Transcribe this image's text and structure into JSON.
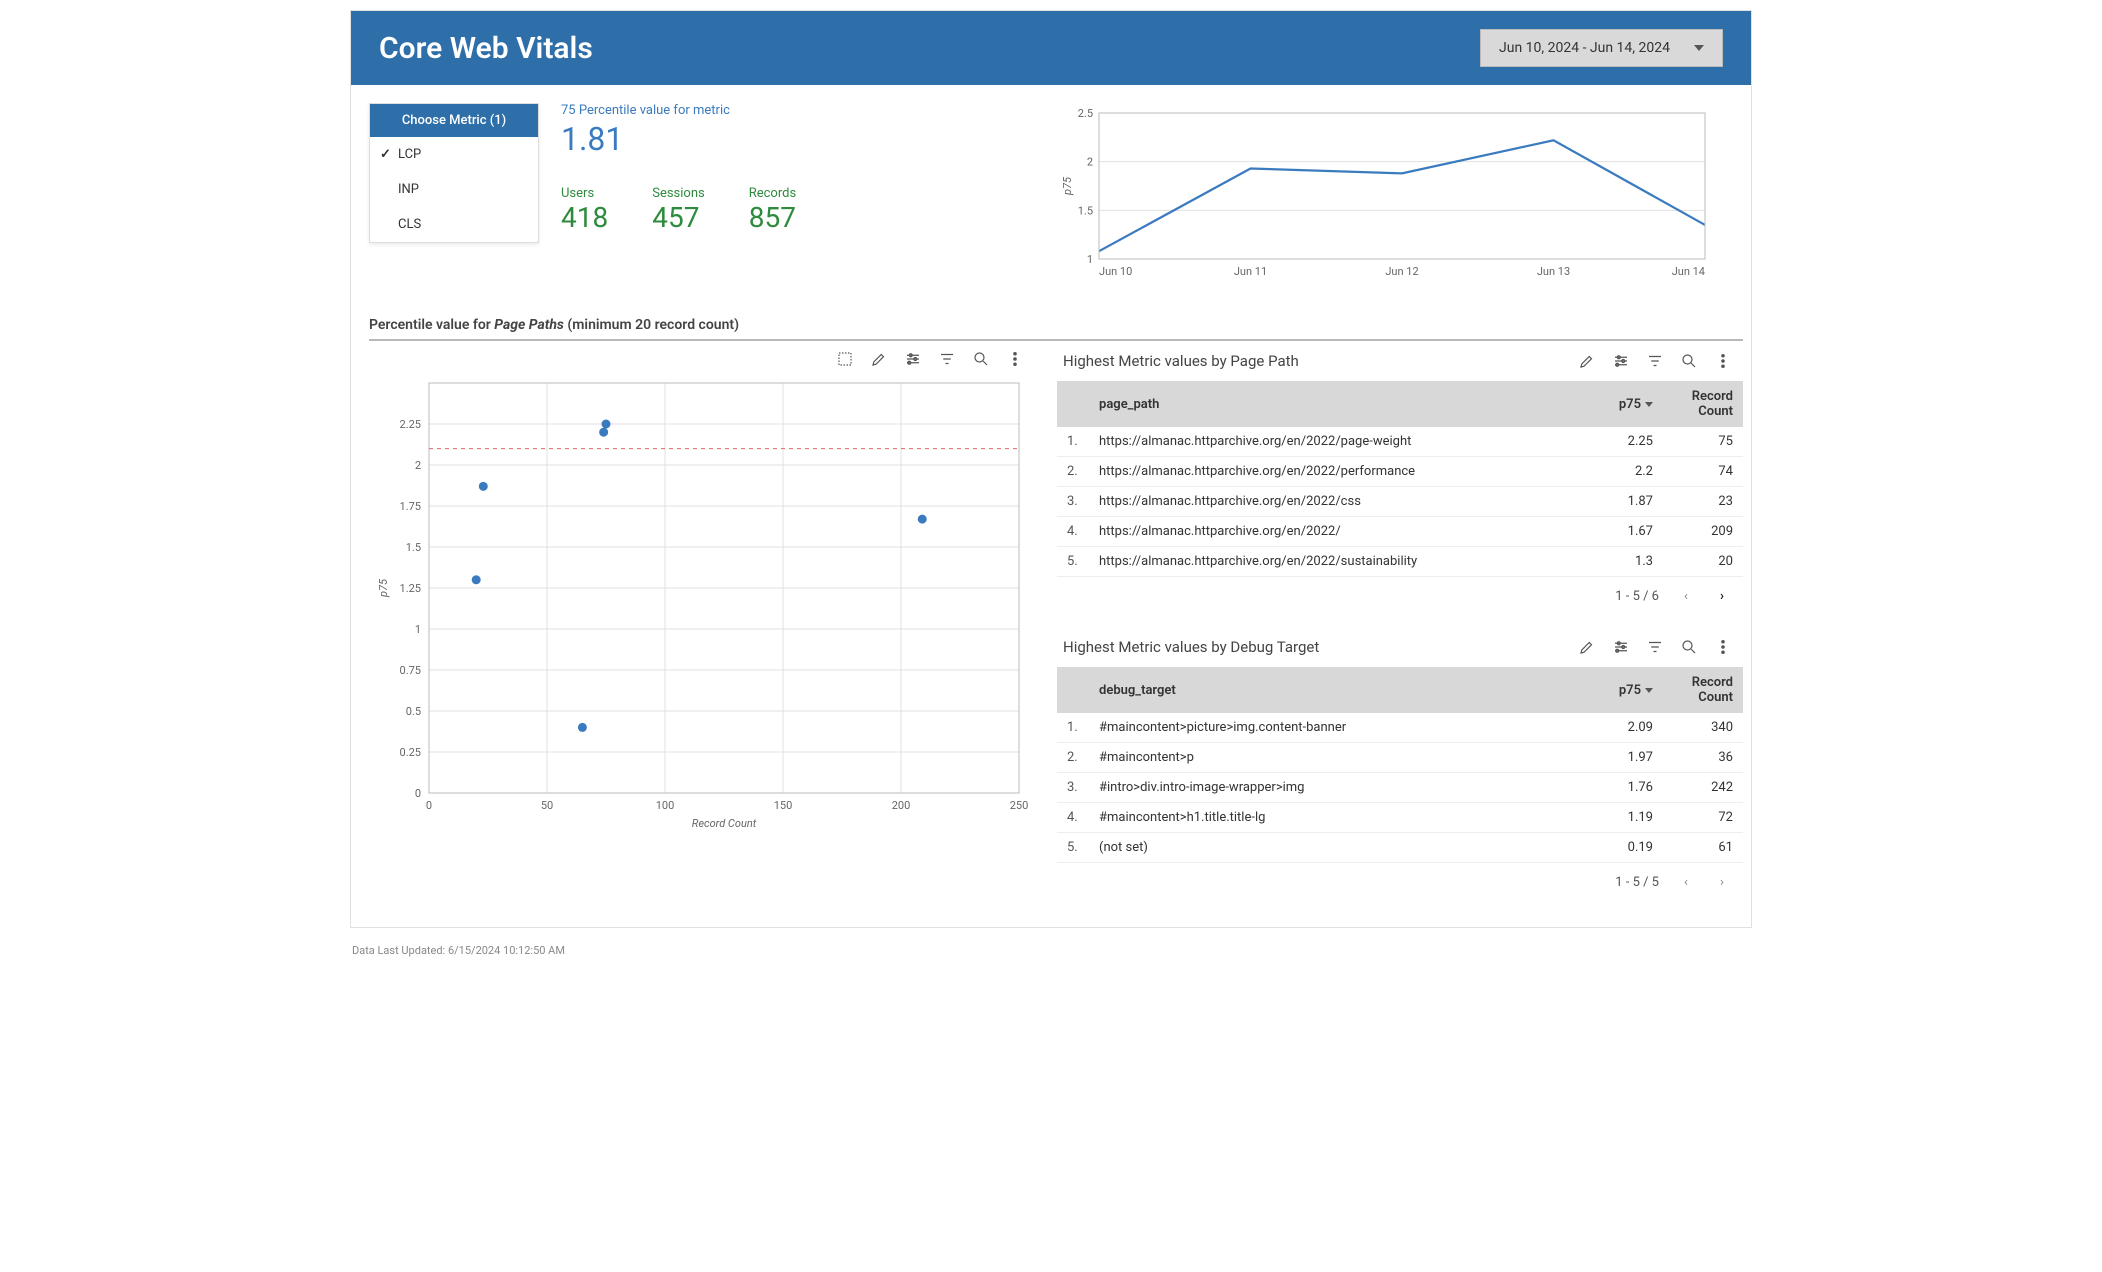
{
  "header": {
    "title": "Core Web Vitals",
    "date_range": "Jun 10, 2024 - Jun 14, 2024"
  },
  "metric_selector": {
    "title": "Choose Metric (1)",
    "items": [
      "LCP",
      "INP",
      "CLS"
    ],
    "selected": "LCP"
  },
  "kpi": {
    "p75_label": "75 Percentile value for metric",
    "p75_value": "1.81",
    "users_label": "Users",
    "users_value": "418",
    "sessions_label": "Sessions",
    "sessions_value": "457",
    "records_label": "Records",
    "records_value": "857"
  },
  "section_label_prefix": "Percentile value for ",
  "section_label_em": "Page Paths",
  "section_label_suffix": " (minimum 20 record count)",
  "page_table": {
    "title": "Highest Metric values by Page Path",
    "headers": {
      "path": "page_path",
      "p75": "p75",
      "count": "Record Count"
    },
    "rows": [
      {
        "path": "https://almanac.httparchive.org/en/2022/page-weight",
        "p75": "2.25",
        "count": "75"
      },
      {
        "path": "https://almanac.httparchive.org/en/2022/performance",
        "p75": "2.2",
        "count": "74"
      },
      {
        "path": "https://almanac.httparchive.org/en/2022/css",
        "p75": "1.87",
        "count": "23"
      },
      {
        "path": "https://almanac.httparchive.org/en/2022/",
        "p75": "1.67",
        "count": "209"
      },
      {
        "path": "https://almanac.httparchive.org/en/2022/sustainability",
        "p75": "1.3",
        "count": "20"
      }
    ],
    "pager": "1 - 5 / 6"
  },
  "debug_table": {
    "title": "Highest Metric values by Debug Target",
    "headers": {
      "target": "debug_target",
      "p75": "p75",
      "count": "Record Count"
    },
    "rows": [
      {
        "target": "#maincontent>picture>img.content-banner",
        "p75": "2.09",
        "count": "340"
      },
      {
        "target": "#maincontent>p",
        "p75": "1.97",
        "count": "36"
      },
      {
        "target": "#intro>div.intro-image-wrapper>img",
        "p75": "1.76",
        "count": "242"
      },
      {
        "target": "#maincontent>h1.title.title-lg",
        "p75": "1.19",
        "count": "72"
      },
      {
        "target": "(not set)",
        "p75": "0.19",
        "count": "61"
      }
    ],
    "pager": "1 - 5 / 5"
  },
  "footer": "Data Last Updated: 6/15/2024 10:12:50 AM",
  "chart_data": [
    {
      "id": "p75_trend",
      "type": "line",
      "title": "",
      "ylabel": "p75",
      "xlabel": "",
      "categories": [
        "Jun 10",
        "Jun 11",
        "Jun 12",
        "Jun 13",
        "Jun 14"
      ],
      "values": [
        1.08,
        1.93,
        1.88,
        2.22,
        1.35
      ],
      "ylim": [
        1,
        2.5
      ],
      "ytick": [
        1,
        1.5,
        2,
        2.5
      ]
    },
    {
      "id": "scatter_page_paths",
      "type": "scatter",
      "xlabel": "Record Count",
      "ylabel": "p75",
      "xlim": [
        0,
        250
      ],
      "xtick": [
        0,
        50,
        100,
        150,
        200,
        250
      ],
      "ylim": [
        0,
        2.5
      ],
      "ytick": [
        0,
        0.25,
        0.5,
        0.75,
        1,
        1.25,
        1.5,
        1.75,
        2,
        2.25
      ],
      "refline_y": 2.1,
      "points": [
        {
          "x": 75,
          "y": 2.25
        },
        {
          "x": 74,
          "y": 2.2
        },
        {
          "x": 23,
          "y": 1.87
        },
        {
          "x": 209,
          "y": 1.67
        },
        {
          "x": 20,
          "y": 1.3
        },
        {
          "x": 65,
          "y": 0.4
        }
      ]
    }
  ]
}
